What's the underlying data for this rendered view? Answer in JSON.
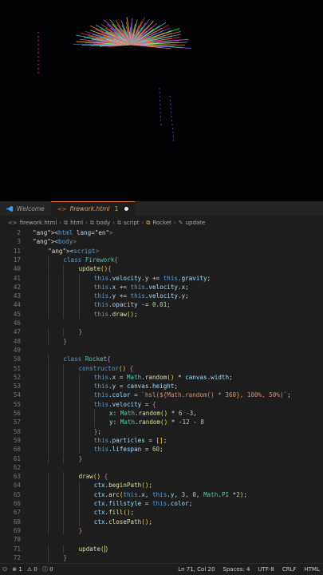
{
  "tabs": [
    {
      "label": "Welcome",
      "active": false
    },
    {
      "label": "firework.html",
      "active": true,
      "badge": "1"
    }
  ],
  "breadcrumb": [
    "firework.html",
    "html",
    "body",
    "script",
    "Rocket",
    "update"
  ],
  "code_lines": [
    {
      "n": "2",
      "indent": 0,
      "text": "<html lang=\"en\">"
    },
    {
      "n": "3",
      "indent": 0,
      "text": "<body>"
    },
    {
      "n": "11",
      "indent": 1,
      "text": "<script>"
    },
    {
      "n": "17",
      "indent": 2,
      "text": "class Firework{"
    },
    {
      "n": "40",
      "indent": 3,
      "text": "update(){"
    },
    {
      "n": "41",
      "indent": 4,
      "text": "this.velocity.y += this.gravity;"
    },
    {
      "n": "42",
      "indent": 4,
      "text": "this.x += this.velocity.x;"
    },
    {
      "n": "43",
      "indent": 4,
      "text": "this.y += this.velocity.y;"
    },
    {
      "n": "44",
      "indent": 4,
      "text": "this.opacity -= 0.01;"
    },
    {
      "n": "45",
      "indent": 4,
      "text": "this.draw();"
    },
    {
      "n": "46",
      "indent": 0,
      "text": ""
    },
    {
      "n": "47",
      "indent": 3,
      "text": "}"
    },
    {
      "n": "48",
      "indent": 2,
      "text": "}"
    },
    {
      "n": "49",
      "indent": 0,
      "text": ""
    },
    {
      "n": "50",
      "indent": 2,
      "text": "class Rocket{"
    },
    {
      "n": "51",
      "indent": 3,
      "text": "constructor() {"
    },
    {
      "n": "52",
      "indent": 4,
      "text": "this.x = Math.random() * canvas.width;"
    },
    {
      "n": "53",
      "indent": 4,
      "text": "this.y = canvas.height;"
    },
    {
      "n": "54",
      "indent": 4,
      "text": "this.color = `hsl(${Math.random() * 360}, 100%, 50%)`;"
    },
    {
      "n": "55",
      "indent": 4,
      "text": "this.velocity = {"
    },
    {
      "n": "56",
      "indent": 5,
      "text": "x: Math.random() * 6 -3,"
    },
    {
      "n": "57",
      "indent": 5,
      "text": "y: Math.random() * -12 - 8"
    },
    {
      "n": "58",
      "indent": 4,
      "text": "};"
    },
    {
      "n": "59",
      "indent": 4,
      "text": "this.particles = [];"
    },
    {
      "n": "60",
      "indent": 4,
      "text": "this.lifespan = 60;"
    },
    {
      "n": "61",
      "indent": 3,
      "text": "}"
    },
    {
      "n": "62",
      "indent": 0,
      "text": ""
    },
    {
      "n": "63",
      "indent": 3,
      "text": "draw() {"
    },
    {
      "n": "64",
      "indent": 4,
      "text": "ctx.beginPath();"
    },
    {
      "n": "65",
      "indent": 4,
      "text": "ctx.arc(this.x, this.y, 3, 0, Math.PI *2);"
    },
    {
      "n": "66",
      "indent": 4,
      "text": "ctx.fillstyle = this.color;"
    },
    {
      "n": "67",
      "indent": 4,
      "text": "ctx.fill();"
    },
    {
      "n": "68",
      "indent": 4,
      "text": "ctx.closePath();"
    },
    {
      "n": "69",
      "indent": 3,
      "text": "}"
    },
    {
      "n": "70",
      "indent": 0,
      "text": ""
    },
    {
      "n": "71",
      "indent": 3,
      "text": "update()"
    },
    {
      "n": "72",
      "indent": 2,
      "text": "}"
    }
  ],
  "status": {
    "errors": "1",
    "warnings": "0",
    "info": "0",
    "position": "Ln 71, Col 20",
    "spaces": "Spaces: 4",
    "encoding": "UTF-8",
    "eol": "CRLF",
    "language": "HTML"
  },
  "colors": {
    "accent": "#e37933",
    "editor_bg": "#1e1e1e",
    "preview_bg": "#020103"
  }
}
